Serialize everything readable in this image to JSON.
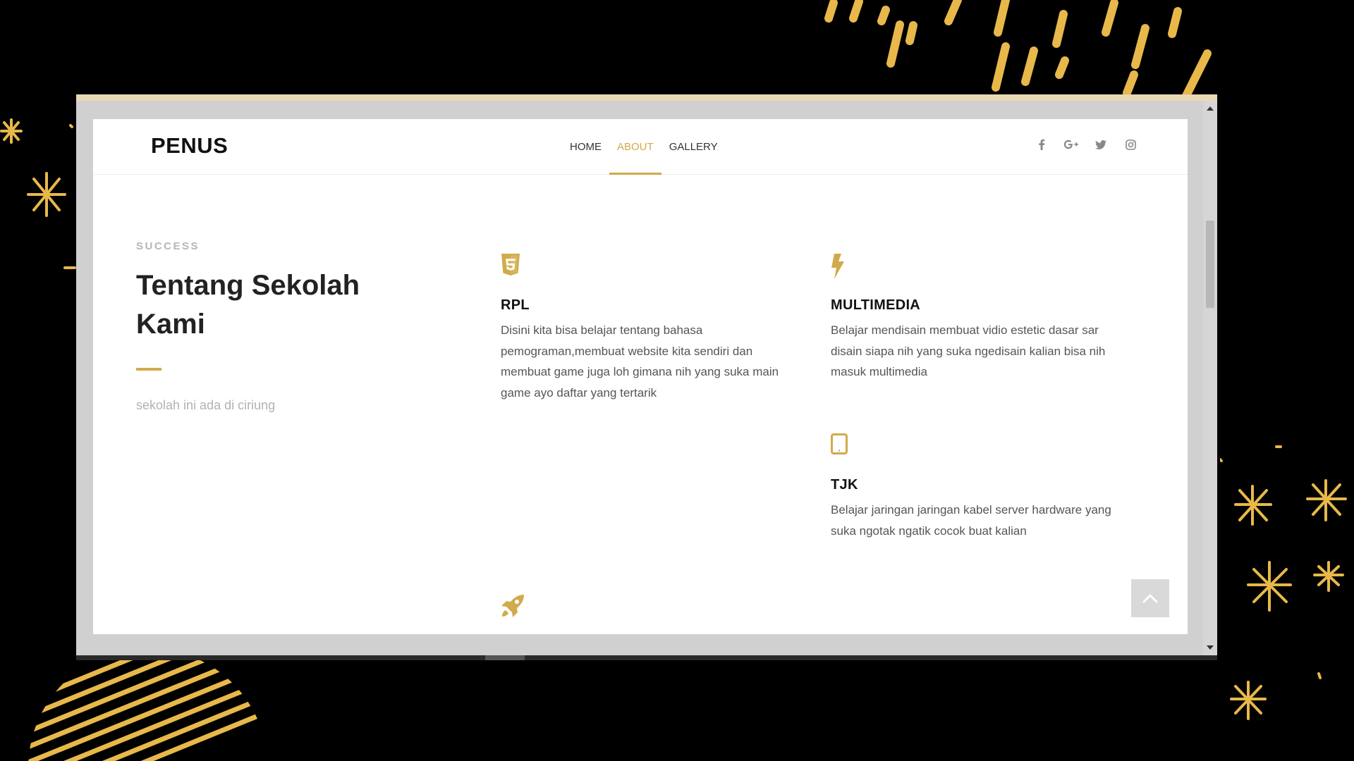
{
  "site": {
    "brand": "PENUS"
  },
  "nav": {
    "items": [
      {
        "label": "HOME",
        "active": false
      },
      {
        "label": "ABOUT",
        "active": true
      },
      {
        "label": "GALLERY",
        "active": false
      }
    ],
    "social_icons": [
      "facebook-icon",
      "google-plus-icon",
      "twitter-icon",
      "instagram-icon"
    ]
  },
  "intro": {
    "eyebrow": "SUCCESS",
    "title_line1": "Tentang Sekolah",
    "title_line2": "Kami",
    "lead": "sekolah ini ada di ciriung"
  },
  "features": [
    {
      "icon": "html5-icon",
      "title": "RPL",
      "description": "Disini kita bisa belajar tentang bahasa pemograman,membuat website kita sendiri dan membuat game juga loh gimana nih yang suka main game ayo daftar yang tertarik"
    },
    {
      "icon": "bolt-icon",
      "title": "MULTIMEDIA",
      "description": "Belajar mendisain membuat vidio estetic dasar sar disain siapa nih yang suka ngedisain kalian bisa nih masuk multimedia"
    },
    {
      "icon": "tablet-icon",
      "title": "TJK",
      "description": "Belajar jaringan jaringan kabel server hardware yang suka ngotak ngatik cocok buat kalian"
    },
    {
      "icon": "rocket-icon",
      "title": "",
      "description": ""
    }
  ],
  "colors": {
    "accent": "#d1ab4b",
    "background": "#000000",
    "page": "#ffffff",
    "deco_gold": "#e8b84a"
  },
  "controls": {
    "back_to_top_icon": "chevron-up-icon"
  }
}
